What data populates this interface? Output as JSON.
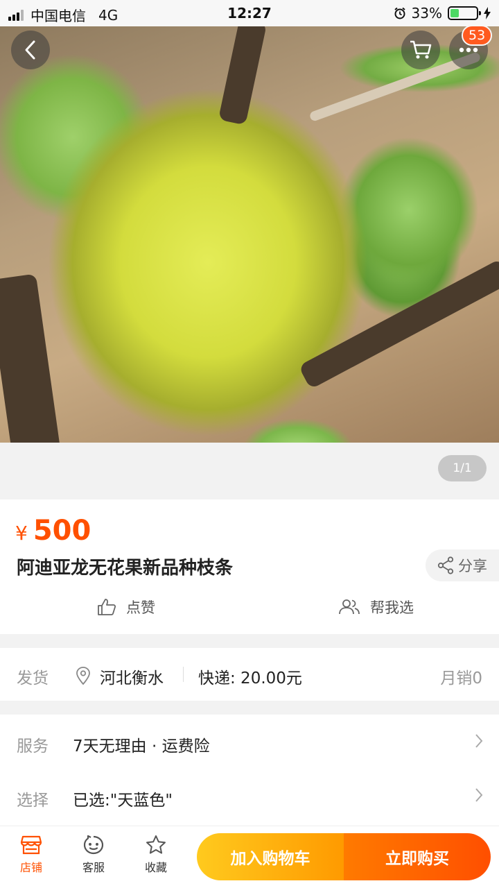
{
  "status_bar": {
    "carrier": "中国电信",
    "network": "4G",
    "time": "12:27",
    "battery": "33%",
    "battery_level": 0.33
  },
  "header": {
    "back_icon": "chevron-left-icon",
    "cart_icon": "cart-icon",
    "more_icon": "more-dots-icon",
    "more_badge": "53"
  },
  "gallery": {
    "counter": "1/1"
  },
  "product": {
    "price_symbol": "¥",
    "price": "500",
    "title": "阿迪亚龙无花果新品种枝条",
    "share_label": "分享",
    "like_label": "点赞",
    "help_choose_label": "帮我选"
  },
  "shipping": {
    "label": "发货",
    "location": "河北衡水",
    "express": "快递: 20.00元",
    "monthly_sales": "月销0"
  },
  "service": {
    "service_label": "服务",
    "service_value": "7天无理由 · 运费险",
    "select_label": "选择",
    "select_value": "已选:\"天蓝色\""
  },
  "bottom_bar": {
    "store": "店铺",
    "support": "客服",
    "favorite": "收藏",
    "add_to_cart": "加入购物车",
    "buy_now": "立即购买"
  },
  "colors": {
    "accent": "#ff5000",
    "cart_gradient_start": "#ffca1e",
    "buy_gradient_end": "#ff4f00"
  }
}
